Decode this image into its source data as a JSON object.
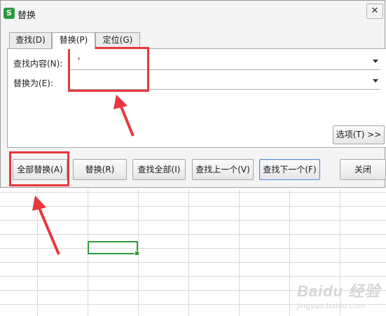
{
  "dialog": {
    "title": "替换",
    "close_glyph": "✕",
    "app_icon_letter": "S"
  },
  "tabs": [
    {
      "label": "查找(D)",
      "active": false
    },
    {
      "label": "替换(P)",
      "active": true
    },
    {
      "label": "定位(G)",
      "active": false
    }
  ],
  "find": {
    "label": "查找内容(N):",
    "value": "'"
  },
  "replace": {
    "label": "替换为(E):",
    "value": ""
  },
  "options_button": "选项(T) >>",
  "buttons": {
    "replace_all": "全部替换(A)",
    "replace": "替换(R)",
    "find_all": "查找全部(I)",
    "find_prev": "查找上一个(V)",
    "find_next": "查找下一个(F)",
    "close": "关闭"
  },
  "watermark": {
    "main": "Baidu 经验",
    "sub": "jingyan.baidu.com"
  },
  "colors": {
    "annotation": "#e8373e",
    "active_cell": "#2e9a3c",
    "app_icon": "#2b9a3f"
  }
}
